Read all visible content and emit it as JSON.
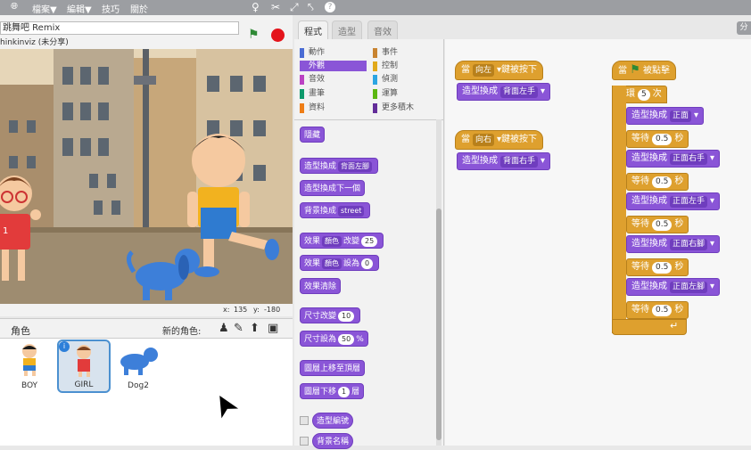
{
  "menubar": {
    "globe_icon": "globe-icon",
    "file_label": "檔案▼",
    "edit_label": "編輯▼",
    "tips_label": "技巧",
    "about_label": "關於",
    "tools": [
      "duplicate-icon",
      "delete-icon",
      "grow-icon",
      "shrink-icon",
      "help-icon"
    ]
  },
  "project": {
    "title": "跳舞吧 Remix",
    "author": "hinkinviz (未分享)"
  },
  "stage": {
    "x_label": "x:",
    "x_value": "135",
    "y_label": "y:",
    "y_value": "-180",
    "girl_number": "1"
  },
  "sprites_panel": {
    "title": "角色",
    "new_sprite_label": "新的角色:",
    "sprites": [
      {
        "name": "BOY"
      },
      {
        "name": "GIRL",
        "selected": true
      },
      {
        "name": "Dog2"
      }
    ]
  },
  "tabs": [
    "程式",
    "造型",
    "音效"
  ],
  "dump_button": "分",
  "categories": {
    "left": [
      {
        "label": "動作",
        "color": "#4a6cd4"
      },
      {
        "label": "外觀",
        "color": "#8a55d7",
        "selected": true
      },
      {
        "label": "音效",
        "color": "#bb42c3"
      },
      {
        "label": "畫筆",
        "color": "#0e9a6c"
      },
      {
        "label": "資料",
        "color": "#ee7d16"
      }
    ],
    "right": [
      {
        "label": "事件",
        "color": "#c88330"
      },
      {
        "label": "控制",
        "color": "#e1a91a"
      },
      {
        "label": "偵測",
        "color": "#2ca5e2"
      },
      {
        "label": "運算",
        "color": "#5cb712"
      },
      {
        "label": "更多積木",
        "color": "#632d99"
      }
    ]
  },
  "palette": {
    "hide": "隱藏",
    "switch_costume": "造型換成",
    "switch_costume_value": "背面左腳",
    "next_costume": "造型換成下一個",
    "switch_backdrop": "背景換成",
    "switch_backdrop_value": "street",
    "change_effect_1": "效果",
    "change_effect_dd": "顏色",
    "change_effect_2": "改變",
    "change_effect_val": "25",
    "set_effect_1": "效果",
    "set_effect_dd": "顏色",
    "set_effect_2": "設為",
    "set_effect_val": "0",
    "clear_effects": "效果清除",
    "change_size": "尺寸改變",
    "change_size_val": "10",
    "set_size": "尺寸設為",
    "set_size_val": "50",
    "set_size_unit": "%",
    "go_front": "圖層上移至頂層",
    "go_back": "圖層下移",
    "go_back_val": "1",
    "go_back_unit": "層",
    "costume_number": "造型編號",
    "backdrop_name": "背景名稱"
  },
  "scripts": {
    "when_key": "當",
    "key_left": "向左",
    "key_right": "向右",
    "pressed": "鍵被按下",
    "switch": "造型換成",
    "back_left": "背面左手",
    "back_right": "背面右手",
    "when_flag_1": "當",
    "when_flag_2": "被點擊",
    "repeat_label": "循環",
    "repeat_count": "5",
    "repeat_unit": "次",
    "wait_label": "等待",
    "wait_value": "0.5",
    "wait_unit": "秒",
    "costume_seq": [
      "正面",
      "正面右手",
      "正面左手",
      "正面右腳",
      "正面左腳"
    ]
  },
  "colors": {
    "looks": "#8a55d7",
    "control": "#dea02e",
    "menubar": "#9c9ea2",
    "selected_sprite": "#4b90d0"
  }
}
